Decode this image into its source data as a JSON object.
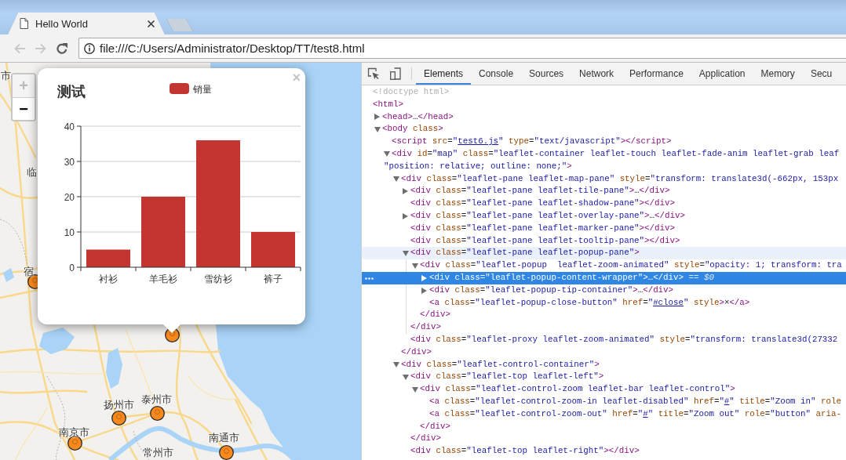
{
  "browser": {
    "tabs": [
      {
        "title": "Hello World",
        "selected": true
      }
    ],
    "nav_buttons": [
      {
        "kind": "back",
        "disabled": true
      },
      {
        "kind": "forward",
        "disabled": true
      },
      {
        "kind": "reload",
        "disabled": false
      }
    ],
    "address": "file:///C:/Users/Administrator/Desktop/TT/test8.html"
  },
  "map": {
    "zoom_buttons": [
      {
        "label": "+",
        "disabled": true
      },
      {
        "label": "−",
        "disabled": false
      }
    ],
    "places": [
      {
        "label": "市",
        "marker": false
      },
      {
        "label": "临",
        "marker": false
      },
      {
        "label": "宿",
        "marker": true
      },
      {
        "marker": true
      },
      {
        "label": "泰州市",
        "marker": true
      },
      {
        "label": "扬州市",
        "marker": true
      },
      {
        "label": "南京市",
        "marker": true
      },
      {
        "label": "南通市",
        "marker": true
      },
      {
        "label": "常州市",
        "marker": false
      }
    ],
    "popup": {
      "close": "×",
      "chart_data": {
        "type": "bar",
        "title": "测试",
        "categories": [
          "衬衫",
          "羊毛衫",
          "雪纺衫",
          "裤子"
        ],
        "series": [
          {
            "name": "销量",
            "color": "#c23531",
            "values": [
              5,
              20,
              36,
              10
            ]
          }
        ],
        "ylim": [
          0,
          40
        ],
        "yticks": [
          0,
          10,
          20,
          30,
          40
        ],
        "grid": true
      }
    }
  },
  "devtools": {
    "tabs": [
      {
        "label": "Elements",
        "selected": true
      },
      {
        "label": "Console",
        "selected": false
      },
      {
        "label": "Sources",
        "selected": false
      },
      {
        "label": "Network",
        "selected": false
      },
      {
        "label": "Performance",
        "selected": false
      },
      {
        "label": "Application",
        "selected": false
      },
      {
        "label": "Memory",
        "selected": false
      },
      {
        "label": "Secu",
        "selected": false
      }
    ],
    "nodes": [
      {
        "lines": [
          [
            {
              "kind": "doctype",
              "text": "<!doctype html>"
            }
          ]
        ],
        "selected": false,
        "hovered": false
      },
      {
        "lines": [
          [
            {
              "kind": "tag",
              "text": "<html>"
            }
          ]
        ],
        "selected": false,
        "hovered": false,
        "children": [
          {
            "expanded": false,
            "lines": [
              [
                {
                  "kind": "tag",
                  "text": "<head>"
                },
                {
                  "kind": "plain",
                  "text": "…"
                },
                {
                  "kind": "tag",
                  "text": "</head>"
                }
              ]
            ],
            "selected": false,
            "hovered": false
          },
          {
            "expanded": true,
            "lines": [
              [
                {
                  "kind": "tag",
                  "text": "<body"
                },
                {
                  "kind": "attr",
                  "text": " class"
                },
                {
                  "kind": "tag",
                  "text": ">"
                }
              ]
            ],
            "selected": false,
            "hovered": false,
            "children": [
              {
                "lines": [
                  [
                    {
                      "kind": "tag",
                      "text": "<script"
                    },
                    {
                      "kind": "attr",
                      "text": " src"
                    },
                    {
                      "kind": "plain",
                      "text": "="
                    },
                    {
                      "kind": "value",
                      "text": "\""
                    },
                    {
                      "kind": "link",
                      "text": "test6.js"
                    },
                    {
                      "kind": "value",
                      "text": "\""
                    },
                    {
                      "kind": "attr",
                      "text": " type"
                    },
                    {
                      "kind": "plain",
                      "text": "="
                    },
                    {
                      "kind": "value",
                      "text": "\"text/javascript\""
                    },
                    {
                      "kind": "tag",
                      "text": "></script>"
                    }
                  ]
                ],
                "selected": false,
                "hovered": false
              },
              {
                "expanded": true,
                "lines": [
                  [
                    {
                      "kind": "tag",
                      "text": "<div"
                    },
                    {
                      "kind": "attr",
                      "text": " id"
                    },
                    {
                      "kind": "plain",
                      "text": "="
                    },
                    {
                      "kind": "value",
                      "text": "\"map\""
                    },
                    {
                      "kind": "attr",
                      "text": " class"
                    },
                    {
                      "kind": "plain",
                      "text": "="
                    },
                    {
                      "kind": "value",
                      "text": "\"leaflet-container leaflet-touch leaflet-fade-anim leaflet-grab leaf"
                    }
                  ],
                  [
                    {
                      "kind": "value",
                      "text": "\"position: relative; outline: none;\""
                    },
                    {
                      "kind": "tag",
                      "text": ">"
                    }
                  ]
                ],
                "selected": false,
                "hovered": false,
                "children": [
                  {
                    "expanded": true,
                    "lines": [
                      [
                        {
                          "kind": "tag",
                          "text": "<div"
                        },
                        {
                          "kind": "attr",
                          "text": " class"
                        },
                        {
                          "kind": "plain",
                          "text": "="
                        },
                        {
                          "kind": "value",
                          "text": "\"leaflet-pane leaflet-map-pane\""
                        },
                        {
                          "kind": "attr",
                          "text": " style"
                        },
                        {
                          "kind": "plain",
                          "text": "="
                        },
                        {
                          "kind": "value",
                          "text": "\"transform: translate3d(-662px, 153px"
                        }
                      ]
                    ],
                    "selected": false,
                    "hovered": false,
                    "children": [
                      {
                        "expanded": false,
                        "lines": [
                          [
                            {
                              "kind": "tag",
                              "text": "<div"
                            },
                            {
                              "kind": "attr",
                              "text": " class"
                            },
                            {
                              "kind": "plain",
                              "text": "="
                            },
                            {
                              "kind": "value",
                              "text": "\"leaflet-pane leaflet-tile-pane\""
                            },
                            {
                              "kind": "tag",
                              "text": ">"
                            },
                            {
                              "kind": "plain",
                              "text": "…"
                            },
                            {
                              "kind": "tag",
                              "text": "</div>"
                            }
                          ]
                        ],
                        "selected": false,
                        "hovered": false
                      },
                      {
                        "lines": [
                          [
                            {
                              "kind": "tag",
                              "text": "<div"
                            },
                            {
                              "kind": "attr",
                              "text": " class"
                            },
                            {
                              "kind": "plain",
                              "text": "="
                            },
                            {
                              "kind": "value",
                              "text": "\"leaflet-pane leaflet-shadow-pane\""
                            },
                            {
                              "kind": "tag",
                              "text": "></div>"
                            }
                          ]
                        ],
                        "selected": false,
                        "hovered": false
                      },
                      {
                        "expanded": false,
                        "lines": [
                          [
                            {
                              "kind": "tag",
                              "text": "<div"
                            },
                            {
                              "kind": "attr",
                              "text": " class"
                            },
                            {
                              "kind": "plain",
                              "text": "="
                            },
                            {
                              "kind": "value",
                              "text": "\"leaflet-pane leaflet-overlay-pane\""
                            },
                            {
                              "kind": "tag",
                              "text": ">"
                            },
                            {
                              "kind": "plain",
                              "text": "…"
                            },
                            {
                              "kind": "tag",
                              "text": "</div>"
                            }
                          ]
                        ],
                        "selected": false,
                        "hovered": false
                      },
                      {
                        "lines": [
                          [
                            {
                              "kind": "tag",
                              "text": "<div"
                            },
                            {
                              "kind": "attr",
                              "text": " class"
                            },
                            {
                              "kind": "plain",
                              "text": "="
                            },
                            {
                              "kind": "value",
                              "text": "\"leaflet-pane leaflet-marker-pane\""
                            },
                            {
                              "kind": "tag",
                              "text": "></div>"
                            }
                          ]
                        ],
                        "selected": false,
                        "hovered": false
                      },
                      {
                        "lines": [
                          [
                            {
                              "kind": "tag",
                              "text": "<div"
                            },
                            {
                              "kind": "attr",
                              "text": " class"
                            },
                            {
                              "kind": "plain",
                              "text": "="
                            },
                            {
                              "kind": "value",
                              "text": "\"leaflet-pane leaflet-tooltip-pane\""
                            },
                            {
                              "kind": "tag",
                              "text": "></div>"
                            }
                          ]
                        ],
                        "selected": false,
                        "hovered": false
                      },
                      {
                        "expanded": true,
                        "lines": [
                          [
                            {
                              "kind": "tag",
                              "text": "<div"
                            },
                            {
                              "kind": "attr",
                              "text": " class"
                            },
                            {
                              "kind": "plain",
                              "text": "="
                            },
                            {
                              "kind": "value",
                              "text": "\"leaflet-pane leaflet-popup-pane\""
                            },
                            {
                              "kind": "tag",
                              "text": ">"
                            }
                          ]
                        ],
                        "selected": false,
                        "hovered": true,
                        "children": [
                          {
                            "expanded": true,
                            "lines": [
                              [
                                {
                                  "kind": "tag",
                                  "text": "<div"
                                },
                                {
                                  "kind": "attr",
                                  "text": " class"
                                },
                                {
                                  "kind": "plain",
                                  "text": "="
                                },
                                {
                                  "kind": "value",
                                  "text": "\"leaflet-popup  leaflet-zoom-animated\""
                                },
                                {
                                  "kind": "attr",
                                  "text": " style"
                                },
                                {
                                  "kind": "plain",
                                  "text": "="
                                },
                                {
                                  "kind": "value",
                                  "text": "\"opacity: 1; transform: tra"
                                }
                              ]
                            ],
                            "selected": false,
                            "hovered": false,
                            "children": [
                              {
                                "expanded": false,
                                "lines": [
                                  [
                                    {
                                      "kind": "tag",
                                      "text": "<div"
                                    },
                                    {
                                      "kind": "attr",
                                      "text": " class"
                                    },
                                    {
                                      "kind": "plain",
                                      "text": "="
                                    },
                                    {
                                      "kind": "value",
                                      "text": "\"leaflet-popup-content-wrapper\""
                                    },
                                    {
                                      "kind": "tag",
                                      "text": ">"
                                    },
                                    {
                                      "kind": "plain",
                                      "text": "…"
                                    },
                                    {
                                      "kind": "tag",
                                      "text": "</div>"
                                    },
                                    {
                                      "kind": "ref",
                                      "text": " == $0"
                                    }
                                  ]
                                ],
                                "selected": true,
                                "hovered": false
                              },
                              {
                                "expanded": false,
                                "lines": [
                                  [
                                    {
                                      "kind": "tag",
                                      "text": "<div"
                                    },
                                    {
                                      "kind": "attr",
                                      "text": " class"
                                    },
                                    {
                                      "kind": "plain",
                                      "text": "="
                                    },
                                    {
                                      "kind": "value",
                                      "text": "\"leaflet-popup-tip-container\""
                                    },
                                    {
                                      "kind": "tag",
                                      "text": ">"
                                    },
                                    {
                                      "kind": "plain",
                                      "text": "…"
                                    },
                                    {
                                      "kind": "tag",
                                      "text": "</div>"
                                    }
                                  ]
                                ],
                                "selected": false,
                                "hovered": false
                              },
                              {
                                "lines": [
                                  [
                                    {
                                      "kind": "tag",
                                      "text": "<a"
                                    },
                                    {
                                      "kind": "attr",
                                      "text": " class"
                                    },
                                    {
                                      "kind": "plain",
                                      "text": "="
                                    },
                                    {
                                      "kind": "value",
                                      "text": "\"leaflet-popup-close-button\""
                                    },
                                    {
                                      "kind": "attr",
                                      "text": " href"
                                    },
                                    {
                                      "kind": "plain",
                                      "text": "="
                                    },
                                    {
                                      "kind": "value",
                                      "text": "\""
                                    },
                                    {
                                      "kind": "link",
                                      "text": "#close"
                                    },
                                    {
                                      "kind": "value",
                                      "text": "\""
                                    },
                                    {
                                      "kind": "attr",
                                      "text": " style"
                                    },
                                    {
                                      "kind": "tag",
                                      "text": ">"
                                    },
                                    {
                                      "kind": "plain",
                                      "text": "×"
                                    },
                                    {
                                      "kind": "tag",
                                      "text": "</a>"
                                    }
                                  ]
                                ],
                                "selected": false,
                                "hovered": false
                              }
                            ],
                            "closing": [
                              {
                                "kind": "tag",
                                "text": "</div>"
                              }
                            ]
                          }
                        ],
                        "closing": [
                          {
                            "kind": "tag",
                            "text": "</div>"
                          }
                        ]
                      },
                      {
                        "lines": [
                          [
                            {
                              "kind": "tag",
                              "text": "<div"
                            },
                            {
                              "kind": "attr",
                              "text": " class"
                            },
                            {
                              "kind": "plain",
                              "text": "="
                            },
                            {
                              "kind": "value",
                              "text": "\"leaflet-proxy leaflet-zoom-animated\""
                            },
                            {
                              "kind": "attr",
                              "text": " style"
                            },
                            {
                              "kind": "plain",
                              "text": "="
                            },
                            {
                              "kind": "value",
                              "text": "\"transform: translate3d(27332"
                            }
                          ]
                        ],
                        "selected": false,
                        "hovered": false
                      }
                    ],
                    "closing": [
                      {
                        "kind": "tag",
                        "text": "</div>"
                      }
                    ]
                  },
                  {
                    "expanded": true,
                    "lines": [
                      [
                        {
                          "kind": "tag",
                          "text": "<div"
                        },
                        {
                          "kind": "attr",
                          "text": " class"
                        },
                        {
                          "kind": "plain",
                          "text": "="
                        },
                        {
                          "kind": "value",
                          "text": "\"leaflet-control-container\""
                        },
                        {
                          "kind": "tag",
                          "text": ">"
                        }
                      ]
                    ],
                    "selected": false,
                    "hovered": false,
                    "children": [
                      {
                        "expanded": true,
                        "lines": [
                          [
                            {
                              "kind": "tag",
                              "text": "<div"
                            },
                            {
                              "kind": "attr",
                              "text": " class"
                            },
                            {
                              "kind": "plain",
                              "text": "="
                            },
                            {
                              "kind": "value",
                              "text": "\"leaflet-top leaflet-left\""
                            },
                            {
                              "kind": "tag",
                              "text": ">"
                            }
                          ]
                        ],
                        "selected": false,
                        "hovered": false,
                        "children": [
                          {
                            "expanded": true,
                            "lines": [
                              [
                                {
                                  "kind": "tag",
                                  "text": "<div"
                                },
                                {
                                  "kind": "attr",
                                  "text": " class"
                                },
                                {
                                  "kind": "plain",
                                  "text": "="
                                },
                                {
                                  "kind": "value",
                                  "text": "\"leaflet-control-zoom leaflet-bar leaflet-control\""
                                },
                                {
                                  "kind": "tag",
                                  "text": ">"
                                }
                              ]
                            ],
                            "selected": false,
                            "hovered": false,
                            "children": [
                              {
                                "lines": [
                                  [
                                    {
                                      "kind": "tag",
                                      "text": "<a"
                                    },
                                    {
                                      "kind": "attr",
                                      "text": " class"
                                    },
                                    {
                                      "kind": "plain",
                                      "text": "="
                                    },
                                    {
                                      "kind": "value",
                                      "text": "\"leaflet-control-zoom-in leaflet-disabled\""
                                    },
                                    {
                                      "kind": "attr",
                                      "text": " href"
                                    },
                                    {
                                      "kind": "plain",
                                      "text": "="
                                    },
                                    {
                                      "kind": "value",
                                      "text": "\""
                                    },
                                    {
                                      "kind": "link",
                                      "text": "#"
                                    },
                                    {
                                      "kind": "value",
                                      "text": "\""
                                    },
                                    {
                                      "kind": "attr",
                                      "text": " title"
                                    },
                                    {
                                      "kind": "plain",
                                      "text": "="
                                    },
                                    {
                                      "kind": "value",
                                      "text": "\"Zoom in\""
                                    },
                                    {
                                      "kind": "attr",
                                      "text": " role"
                                    }
                                  ]
                                ],
                                "selected": false,
                                "hovered": false
                              },
                              {
                                "lines": [
                                  [
                                    {
                                      "kind": "tag",
                                      "text": "<a"
                                    },
                                    {
                                      "kind": "attr",
                                      "text": " class"
                                    },
                                    {
                                      "kind": "plain",
                                      "text": "="
                                    },
                                    {
                                      "kind": "value",
                                      "text": "\"leaflet-control-zoom-out\""
                                    },
                                    {
                                      "kind": "attr",
                                      "text": " href"
                                    },
                                    {
                                      "kind": "plain",
                                      "text": "="
                                    },
                                    {
                                      "kind": "value",
                                      "text": "\""
                                    },
                                    {
                                      "kind": "link",
                                      "text": "#"
                                    },
                                    {
                                      "kind": "value",
                                      "text": "\""
                                    },
                                    {
                                      "kind": "attr",
                                      "text": " title"
                                    },
                                    {
                                      "kind": "plain",
                                      "text": "="
                                    },
                                    {
                                      "kind": "value",
                                      "text": "\"Zoom out\""
                                    },
                                    {
                                      "kind": "attr",
                                      "text": " role"
                                    },
                                    {
                                      "kind": "plain",
                                      "text": "="
                                    },
                                    {
                                      "kind": "value",
                                      "text": "\"button\""
                                    },
                                    {
                                      "kind": "attr",
                                      "text": " aria-"
                                    }
                                  ]
                                ],
                                "selected": false,
                                "hovered": false
                              }
                            ],
                            "closing": [
                              {
                                "kind": "tag",
                                "text": "</div>"
                              }
                            ]
                          }
                        ],
                        "closing": [
                          {
                            "kind": "tag",
                            "text": "</div>"
                          }
                        ]
                      },
                      {
                        "lines": [
                          [
                            {
                              "kind": "tag",
                              "text": "<div"
                            },
                            {
                              "kind": "attr",
                              "text": " class"
                            },
                            {
                              "kind": "plain",
                              "text": "="
                            },
                            {
                              "kind": "value",
                              "text": "\"leaflet-top leaflet-right\""
                            },
                            {
                              "kind": "tag",
                              "text": "></div>"
                            }
                          ]
                        ],
                        "selected": false,
                        "hovered": false
                      }
                    ]
                  }
                ]
              }
            ]
          }
        ]
      }
    ]
  }
}
